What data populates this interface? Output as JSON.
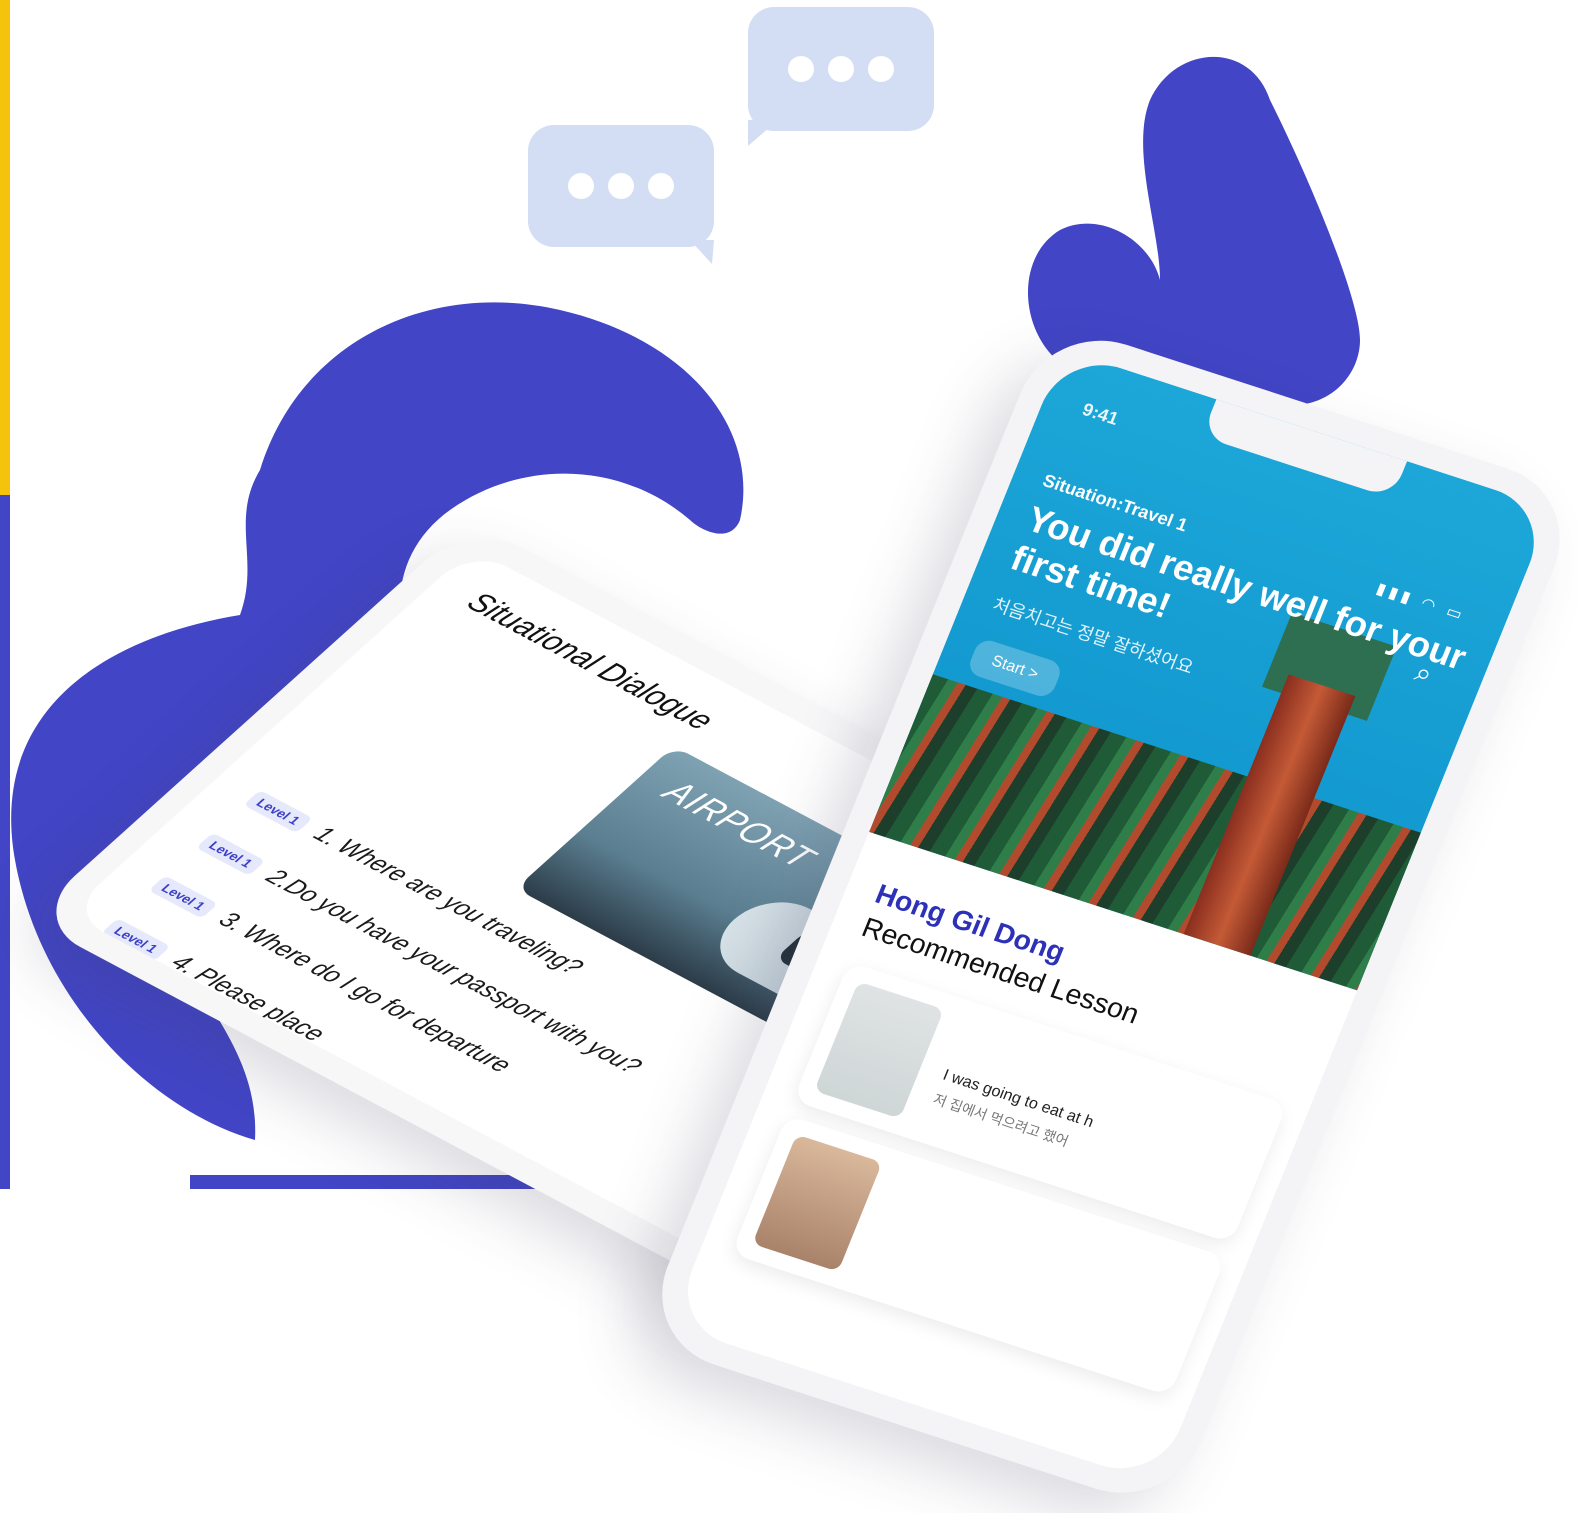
{
  "colors": {
    "accent": "#4245c5",
    "yellow": "#f6c30c",
    "bubble": "#d3def5",
    "sky": "#109ad2"
  },
  "decor": {
    "bubble_icon": "ellipsis-icon"
  },
  "phone_left": {
    "title": "Situational Dialogue",
    "card_label": "AIRPORT",
    "questions": [
      {
        "level": "Level 1",
        "text": "1. Where are you traveling?"
      },
      {
        "level": "Level 1",
        "text": "2.Do you have your passport with you?"
      },
      {
        "level": "Level 1",
        "text": "3. Where do I go for departure"
      },
      {
        "level": "Level 1",
        "text": "4. Please place"
      },
      {
        "level": "Level 1",
        "text": ""
      }
    ]
  },
  "phone_right": {
    "status_time": "9:41",
    "situation_label": "Situation:Travel 1",
    "headline": "You did really well for your first time!",
    "headline_korean": "처음치고는 정말 잘하셨어요",
    "start_button": "Start >",
    "user_name": "Hong Gil Dong",
    "recommended_title": "Recommended Lesson",
    "lessons": [
      {
        "text": "I was going to eat at h",
        "korean": "저 집에서 먹으려고 했어"
      },
      {
        "text": "",
        "korean": ""
      }
    ]
  }
}
